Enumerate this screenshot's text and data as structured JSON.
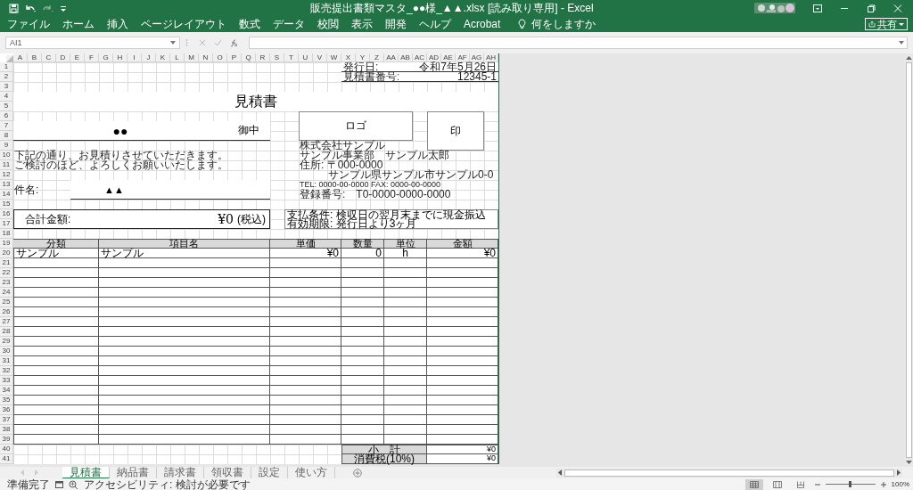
{
  "window": {
    "title": "販売提出書類マスタ_●●様_▲▲.xlsx  [読み取り専用]  -  Excel"
  },
  "ribbon_tabs": [
    "ファイル",
    "ホーム",
    "挿入",
    "ページレイアウト",
    "数式",
    "データ",
    "校閲",
    "表示",
    "開発",
    "ヘルプ",
    "Acrobat"
  ],
  "tell_me": "何をしますか",
  "share_button": "共有",
  "formula_bar": {
    "name_box": "AI1"
  },
  "sheet": {
    "columns": [
      "A",
      "B",
      "C",
      "D",
      "E",
      "F",
      "G",
      "H",
      "I",
      "J",
      "K",
      "L",
      "M",
      "N",
      "O",
      "P",
      "Q",
      "R",
      "S",
      "T",
      "U",
      "V",
      "W",
      "X",
      "Y",
      "Z",
      "AA",
      "AB",
      "AC",
      "AD",
      "AE",
      "AF",
      "AG",
      "AH"
    ],
    "rows": [
      "1",
      "2",
      "3",
      "4",
      "5",
      "6",
      "7",
      "8",
      "9",
      "10",
      "11",
      "12",
      "13",
      "14",
      "15",
      "16",
      "17",
      "18",
      "19",
      "20",
      "21",
      "22",
      "23",
      "24",
      "25",
      "26",
      "27",
      "28",
      "29",
      "30",
      "31",
      "32",
      "33",
      "34",
      "35",
      "36",
      "37",
      "38",
      "39",
      "40",
      "41"
    ],
    "issue_date_label": "発行日:",
    "issue_date": "令和7年5月26日",
    "number_label": "見積書番号:",
    "number": "12345-1",
    "title": "見積書",
    "recipient": "●●",
    "honorific": "御中",
    "logo": "ロゴ",
    "seal": "印",
    "company_lines": [
      "株式会社サンプル",
      "サンプル事業部　サンプル太郎",
      "住所: 〒000-0000",
      "サンプル県サンプル市サンプル0-0",
      "TEL: 0000-00-0000  FAX: 0000-00-0000",
      "登録番号:　T0-0000-0000-0000"
    ],
    "greeting": [
      "下記の通り、お見積りさせていただきます。",
      "ご検討のほど、よろしくお願いいたします。"
    ],
    "subject_label": "件名:",
    "subject": "▲▲",
    "total_label": "合計金額:",
    "total": "¥0",
    "tax_note": "(税込)",
    "terms": [
      "支払条件: 検収日の翌月末までに現金振込",
      "有効期限: 発行日より3ヶ月"
    ],
    "table": {
      "columns": [
        "分類",
        "項目名",
        "単価",
        "数量",
        "単位",
        "金額"
      ],
      "rows": [
        [
          "サンプル",
          "サンプル",
          "¥0",
          "0",
          "h",
          "¥0"
        ]
      ]
    },
    "subtotal_label": "小　計",
    "subtotal": "¥0",
    "tax_label": "消費税(10%)",
    "tax": "¥0"
  },
  "sheet_tabs": [
    {
      "label": "見積書",
      "selected": true
    },
    {
      "label": "納品書",
      "selected": false
    },
    {
      "label": "請求書",
      "selected": false
    },
    {
      "label": "領収書",
      "selected": false
    },
    {
      "label": "設定",
      "selected": false
    },
    {
      "label": "使い方",
      "selected": false
    }
  ],
  "status_bar": {
    "ready": "準備完了",
    "accessibility": "アクセシビリティ: 検討が必要です",
    "views": [
      {
        "kind": "normal",
        "selected": true
      },
      {
        "kind": "page_layout",
        "selected": false
      },
      {
        "kind": "page_break",
        "selected": false
      }
    ],
    "zoom_slider": {
      "level": 0.5
    },
    "zoom": "100%"
  }
}
